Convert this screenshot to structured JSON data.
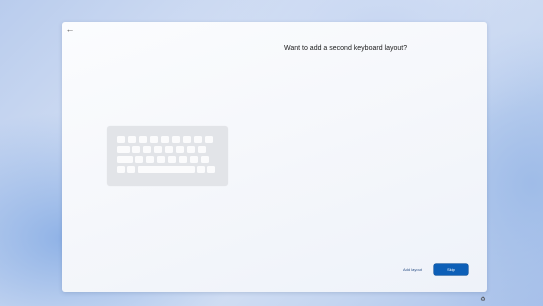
{
  "oobe": {
    "back_icon": "back-arrow-icon",
    "title": "Want to add a second keyboard layout?",
    "illustration_icon": "keyboard-illustration-icon",
    "add_layout_label": "Add layout",
    "skip_label": "Skip",
    "skip_color": "#0d5fb7",
    "accessibility_icon": "accessibility-icon"
  }
}
